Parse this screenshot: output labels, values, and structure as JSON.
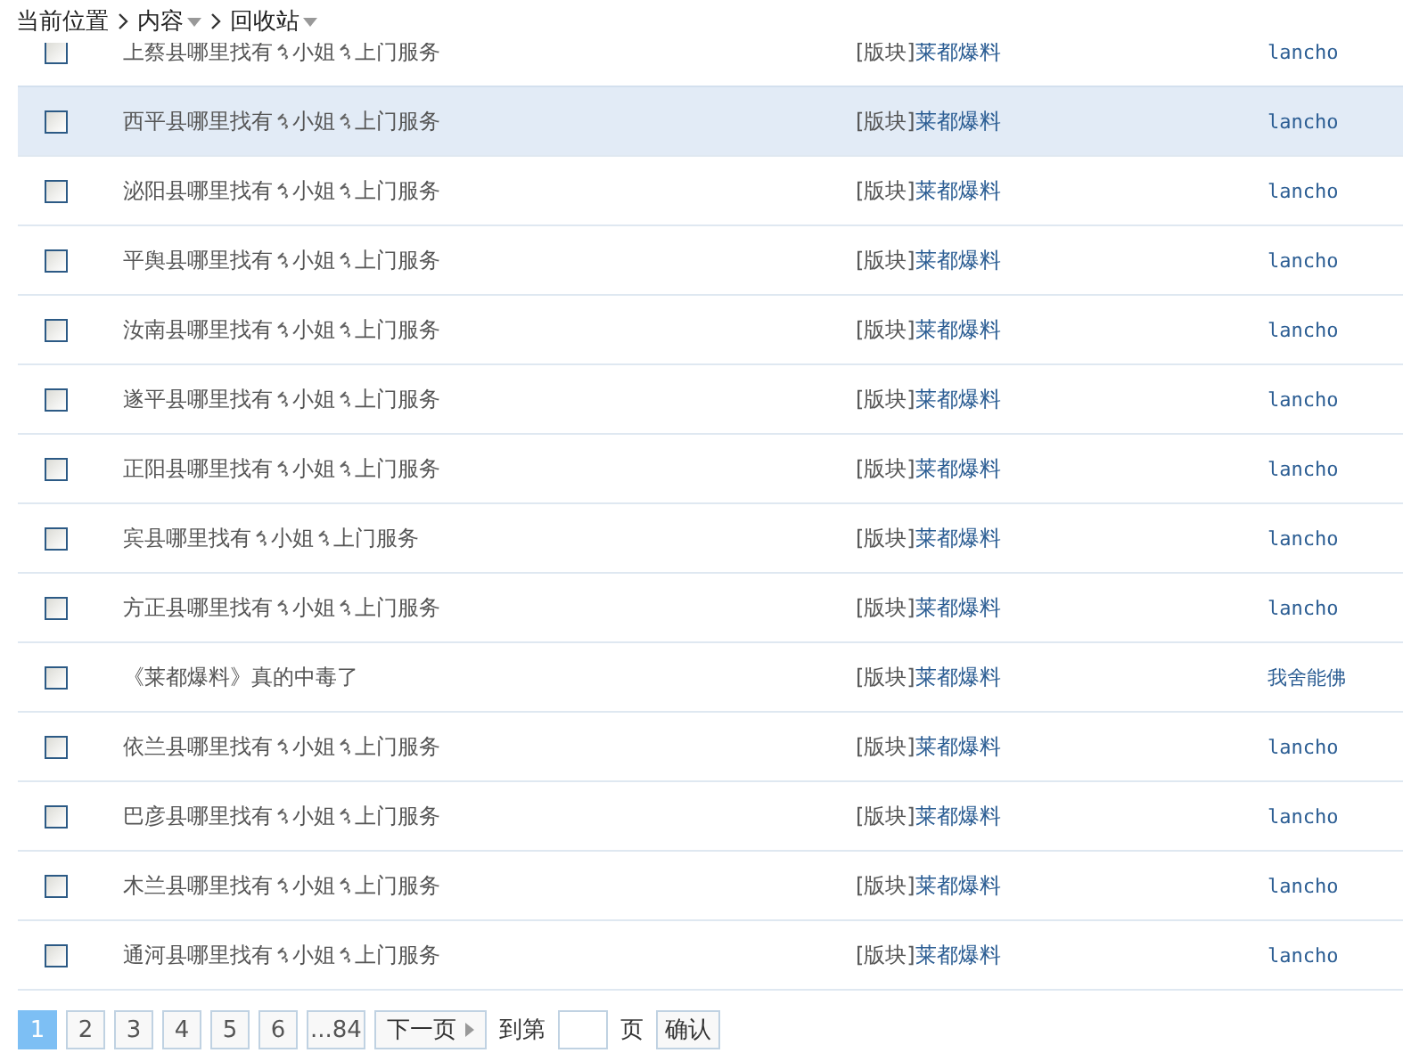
{
  "breadcrumb": {
    "label": "当前位置",
    "items": [
      {
        "text": "内容",
        "dropdown": true
      },
      {
        "text": "回收站",
        "dropdown": true
      }
    ]
  },
  "rows": [
    {
      "title_parts": [
        "上蔡县哪里找有",
        "小姐",
        "上门服务"
      ],
      "prefix": "[版块]",
      "board": "莱都爆料",
      "author": "lancho",
      "checked": false,
      "highlighted": false
    },
    {
      "title_parts": [
        "西平县哪里找有",
        "小姐",
        "上门服务"
      ],
      "prefix": "[版块]",
      "board": "莱都爆料",
      "author": "lancho",
      "checked": false,
      "highlighted": true
    },
    {
      "title_parts": [
        "泌阳县哪里找有",
        "小姐",
        "上门服务"
      ],
      "prefix": "[版块]",
      "board": "莱都爆料",
      "author": "lancho",
      "checked": false,
      "highlighted": false
    },
    {
      "title_parts": [
        "平舆县哪里找有",
        "小姐",
        "上门服务"
      ],
      "prefix": "[版块]",
      "board": "莱都爆料",
      "author": "lancho",
      "checked": false,
      "highlighted": false
    },
    {
      "title_parts": [
        "汝南县哪里找有",
        "小姐",
        "上门服务"
      ],
      "prefix": "[版块]",
      "board": "莱都爆料",
      "author": "lancho",
      "checked": false,
      "highlighted": false
    },
    {
      "title_parts": [
        "遂平县哪里找有",
        "小姐",
        "上门服务"
      ],
      "prefix": "[版块]",
      "board": "莱都爆料",
      "author": "lancho",
      "checked": false,
      "highlighted": false
    },
    {
      "title_parts": [
        "正阳县哪里找有",
        "小姐",
        "上门服务"
      ],
      "prefix": "[版块]",
      "board": "莱都爆料",
      "author": "lancho",
      "checked": false,
      "highlighted": false
    },
    {
      "title_parts": [
        "宾县哪里找有",
        "小姐",
        "上门服务"
      ],
      "prefix": "[版块]",
      "board": "莱都爆料",
      "author": "lancho",
      "checked": false,
      "highlighted": false
    },
    {
      "title_parts": [
        "方正县哪里找有",
        "小姐",
        "上门服务"
      ],
      "prefix": "[版块]",
      "board": "莱都爆料",
      "author": "lancho",
      "checked": false,
      "highlighted": false
    },
    {
      "title_parts": [
        "《莱都爆料》真的中毒了"
      ],
      "prefix": "[版块]",
      "board": "莱都爆料",
      "author": "我舍能佛",
      "checked": false,
      "highlighted": false
    },
    {
      "title_parts": [
        "依兰县哪里找有",
        "小姐",
        "上门服务"
      ],
      "prefix": "[版块]",
      "board": "莱都爆料",
      "author": "lancho",
      "checked": false,
      "highlighted": false
    },
    {
      "title_parts": [
        "巴彦县哪里找有",
        "小姐",
        "上门服务"
      ],
      "prefix": "[版块]",
      "board": "莱都爆料",
      "author": "lancho",
      "checked": false,
      "highlighted": false
    },
    {
      "title_parts": [
        "木兰县哪里找有",
        "小姐",
        "上门服务"
      ],
      "prefix": "[版块]",
      "board": "莱都爆料",
      "author": "lancho",
      "checked": false,
      "highlighted": false
    },
    {
      "title_parts": [
        "通河县哪里找有",
        "小姐",
        "上门服务"
      ],
      "prefix": "[版块]",
      "board": "莱都爆料",
      "author": "lancho",
      "checked": false,
      "highlighted": false
    }
  ],
  "pagination": {
    "pages": [
      {
        "label": "1",
        "selected": true
      },
      {
        "label": "2",
        "selected": false
      },
      {
        "label": "3",
        "selected": false
      },
      {
        "label": "4",
        "selected": false
      },
      {
        "label": "5",
        "selected": false
      },
      {
        "label": "6",
        "selected": false
      },
      {
        "label": "...84",
        "selected": false
      }
    ],
    "next": "下一页",
    "goto_label": "到第",
    "page_unit": "页",
    "confirm": "确认"
  }
}
